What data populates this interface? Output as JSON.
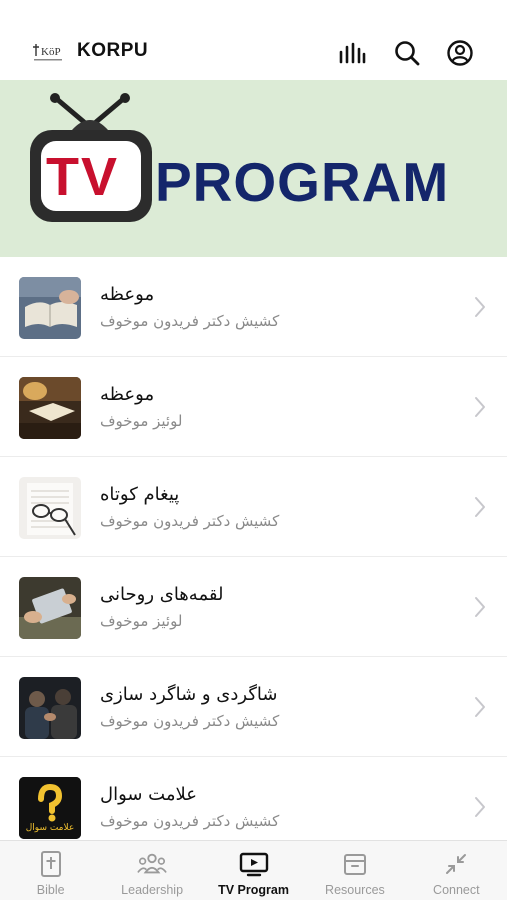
{
  "header": {
    "brand": "KORPU",
    "icons": [
      "logo-icon",
      "equalizer-icon",
      "search-icon",
      "account-icon"
    ]
  },
  "banner": {
    "tv_text": "TV",
    "program_text": "PROGRAM",
    "colors": {
      "background": "#dcebd6",
      "tv_red": "#c8102e",
      "navy": "#14266b"
    }
  },
  "list": {
    "items": [
      {
        "title": "موعظه",
        "subtitle": "کشیش دکتر فریدون موخوف",
        "thumb": "book-reading-image"
      },
      {
        "title": "موعظه",
        "subtitle": "لوئیز موخوف",
        "thumb": "bible-study-image"
      },
      {
        "title": "پیغام کوتاه",
        "subtitle": "کشیش دکتر فریدون موخوف",
        "thumb": "glasses-on-book-image"
      },
      {
        "title": "لقمه‌های روحانی",
        "subtitle": "لوئیز موخوف",
        "thumb": "hands-holding-tablet-image"
      },
      {
        "title": "شاگردی و شاگرد سازی",
        "subtitle": "کشیش دکتر فریدون موخوف",
        "thumb": "group-prayer-image"
      },
      {
        "title": "علامت سوال",
        "subtitle": "کشیش دکتر فریدون موخوف",
        "thumb": "question-mark-logo-image",
        "thumb_text": "علامت سوال"
      }
    ]
  },
  "tabbar": {
    "tabs": [
      {
        "label": "Bible",
        "icon": "bible-icon",
        "active": false
      },
      {
        "label": "Leadership",
        "icon": "leadership-icon",
        "active": false
      },
      {
        "label": "TV Program",
        "icon": "tv-icon",
        "active": true
      },
      {
        "label": "Resources",
        "icon": "resources-icon",
        "active": false
      },
      {
        "label": "Connect",
        "icon": "connect-icon",
        "active": false
      }
    ]
  }
}
